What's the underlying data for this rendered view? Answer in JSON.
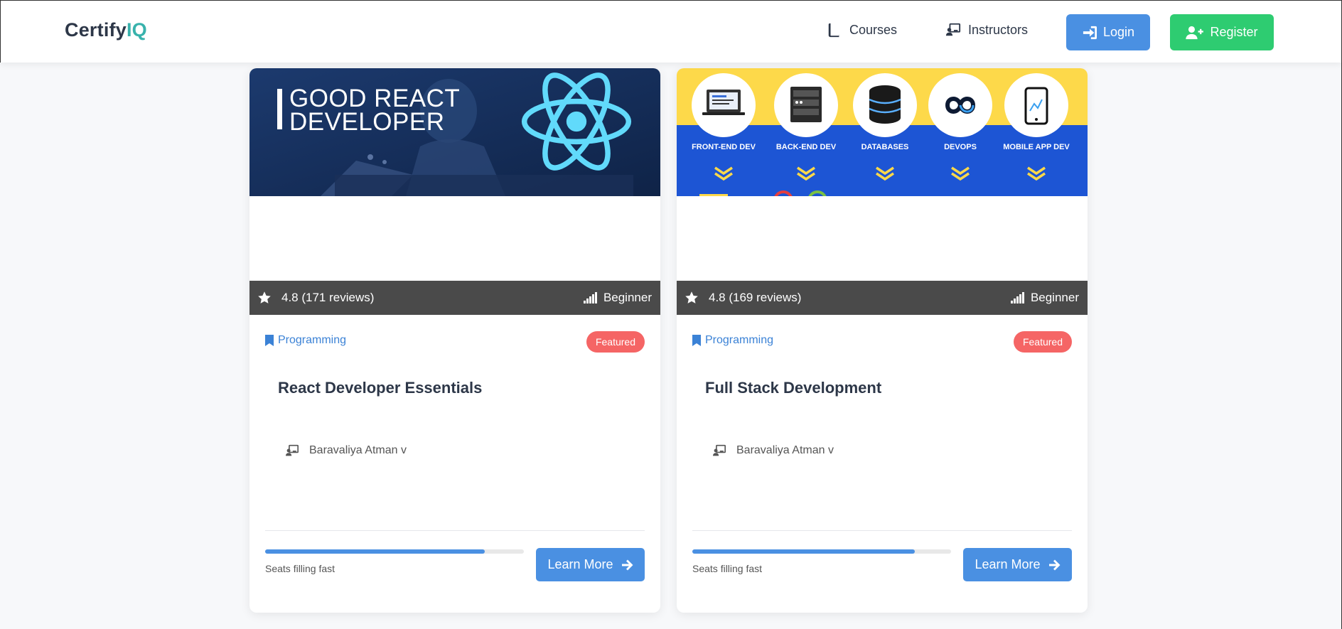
{
  "header": {
    "logo_main": "Certify",
    "logo_accent": "IQ",
    "nav": {
      "courses": "Courses",
      "instructors": "Instructors"
    },
    "login": "Login",
    "register": "Register"
  },
  "cards": [
    {
      "image_text_line1": "GOOD REACT",
      "image_text_line2": "DEVELOPER",
      "rating": "4.8 (171 reviews)",
      "level": "Beginner",
      "category": "Programming",
      "badge": "Featured",
      "title": "React Developer Essentials",
      "instructor": "Baravaliya Atman v",
      "seats_text": "Seats filling fast",
      "seats_progress": 0.85,
      "cta": "Learn More"
    },
    {
      "image_labels": [
        "FRONT-END DEV",
        "BACK-END DEV",
        "DATABASES",
        "DEVOPS",
        "MOBILE APP DEV"
      ],
      "rating": "4.8 (169 reviews)",
      "level": "Beginner",
      "category": "Programming",
      "badge": "Featured",
      "title": "Full Stack Development",
      "instructor": "Baravaliya Atman v",
      "seats_text": "Seats filling fast",
      "seats_progress": 0.86,
      "cta": "Learn More"
    }
  ],
  "colors": {
    "primary": "#4a90e2",
    "success": "#2ecc71",
    "accent": "#38b2ac",
    "badge": "#f56565",
    "meta_bar": "#4a4a4a"
  },
  "icons": [
    "book-icon",
    "chalkboard-teacher-icon",
    "sign-in-icon",
    "user-plus-icon",
    "star-icon",
    "signal-icon",
    "bookmark-icon",
    "arrow-right-icon"
  ]
}
